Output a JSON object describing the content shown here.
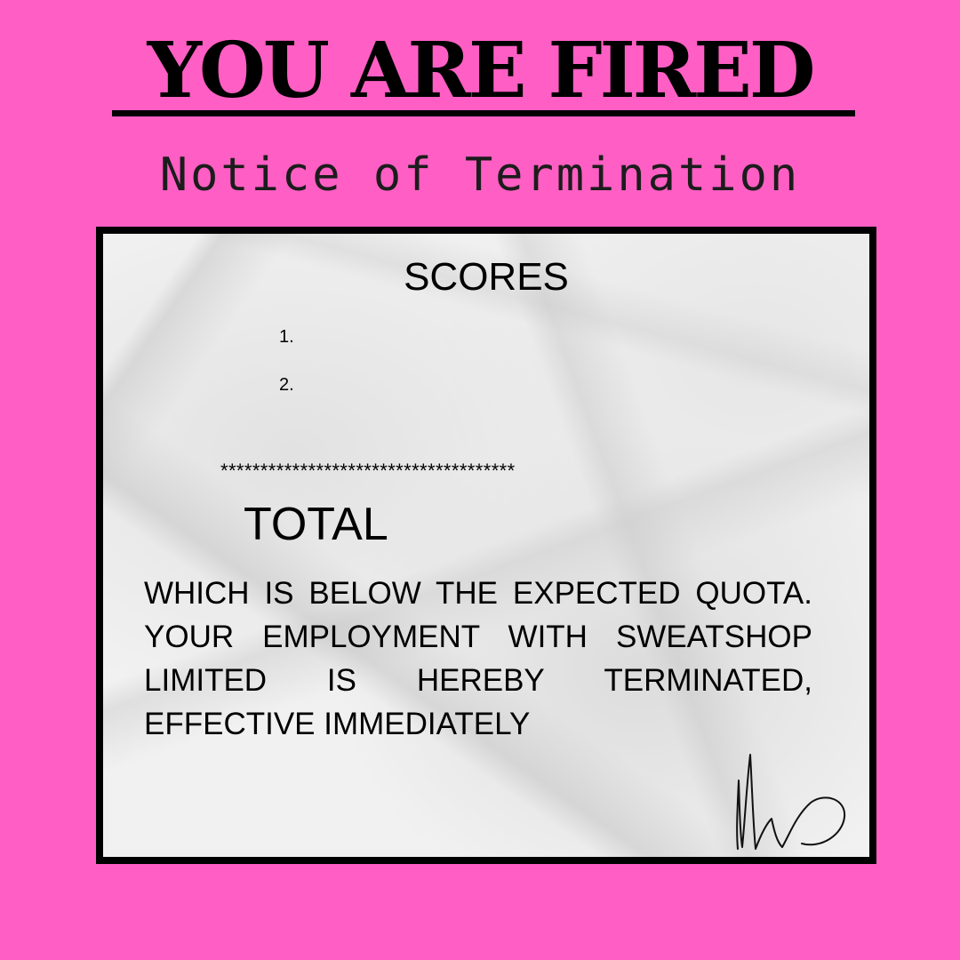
{
  "header": {
    "title": "YOU ARE FIRED",
    "subtitle": "Notice of Termination"
  },
  "notice": {
    "scores_title": "SCORES",
    "score_items": [
      "1.",
      "2."
    ],
    "separator": "*************************************",
    "total_label": "TOTAL",
    "body": "WHICH IS BELOW THE EXPECTED QUOTA. YOUR EMPLOYMENT WITH SWEATSHOP LIMITED IS HEREBY TERMINATED, EFFECTIVE IMMEDIATELY"
  },
  "colors": {
    "background": "#ff5fc4",
    "paper": "#f1f1f1",
    "ink": "#000000"
  },
  "icons": {
    "signature": "handwritten-signature-icon"
  }
}
